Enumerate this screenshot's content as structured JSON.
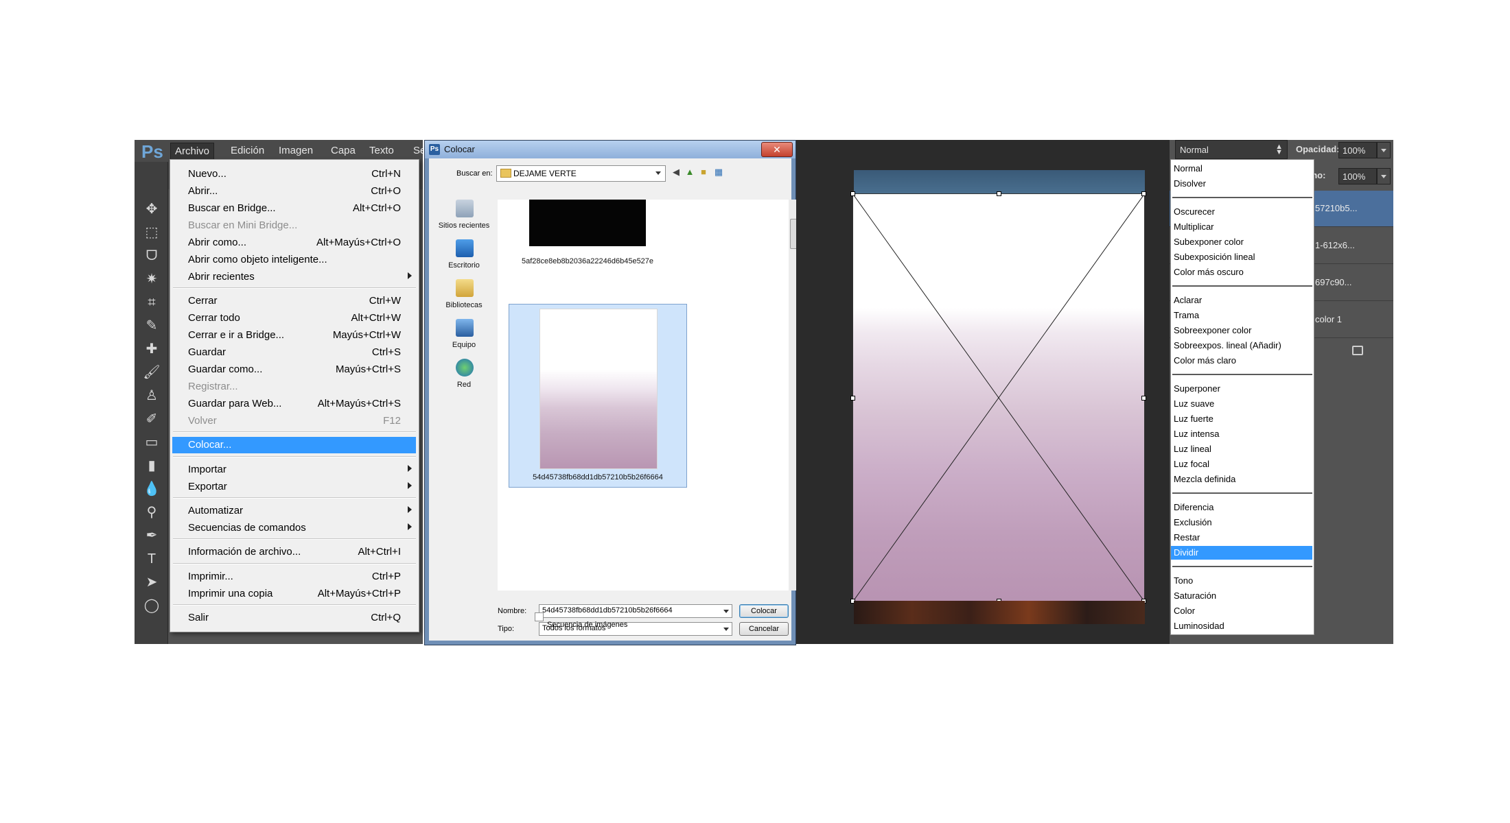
{
  "photoshop": {
    "logo": "Ps",
    "menubar": [
      "Archivo",
      "Edición",
      "Imagen",
      "Capa",
      "Texto",
      "Se"
    ],
    "archivo_menu": [
      {
        "label": "Nuevo...",
        "shortcut": "Ctrl+N"
      },
      {
        "label": "Abrir...",
        "shortcut": "Ctrl+O"
      },
      {
        "label": "Buscar en Bridge...",
        "shortcut": "Alt+Ctrl+O"
      },
      {
        "label": "Buscar en Mini Bridge...",
        "shortcut": ""
      },
      {
        "label": "Abrir como...",
        "shortcut": "Alt+Mayús+Ctrl+O"
      },
      {
        "label": "Abrir como objeto inteligente...",
        "shortcut": ""
      },
      {
        "label": "Abrir recientes",
        "shortcut": ""
      },
      {
        "label": "Cerrar",
        "shortcut": "Ctrl+W"
      },
      {
        "label": "Cerrar todo",
        "shortcut": "Alt+Ctrl+W"
      },
      {
        "label": "Cerrar e ir a Bridge...",
        "shortcut": "Mayús+Ctrl+W"
      },
      {
        "label": "Guardar",
        "shortcut": "Ctrl+S"
      },
      {
        "label": "Guardar como...",
        "shortcut": "Mayús+Ctrl+S"
      },
      {
        "label": "Registrar...",
        "shortcut": ""
      },
      {
        "label": "Guardar para Web...",
        "shortcut": "Alt+Mayús+Ctrl+S"
      },
      {
        "label": "Volver",
        "shortcut": "F12"
      },
      {
        "label": "Colocar...",
        "shortcut": ""
      },
      {
        "label": "Importar",
        "shortcut": ""
      },
      {
        "label": "Exportar",
        "shortcut": ""
      },
      {
        "label": "Automatizar",
        "shortcut": ""
      },
      {
        "label": "Secuencias de comandos",
        "shortcut": ""
      },
      {
        "label": "Información de archivo...",
        "shortcut": "Alt+Ctrl+I"
      },
      {
        "label": "Imprimir...",
        "shortcut": "Ctrl+P"
      },
      {
        "label": "Imprimir una copia",
        "shortcut": "Alt+Mayús+Ctrl+P"
      },
      {
        "label": "Salir",
        "shortcut": "Ctrl+Q"
      }
    ],
    "tool_icons": [
      "move-tool-icon",
      "marquee-tool-icon",
      "lasso-tool-icon",
      "magic-wand-icon",
      "crop-tool-icon",
      "eyedropper-icon",
      "healing-brush-icon",
      "brush-tool-icon",
      "stamp-tool-icon",
      "history-brush-icon",
      "eraser-icon",
      "gradient-tool-icon",
      "blur-tool-icon",
      "dodge-tool-icon",
      "pen-tool-icon",
      "type-tool-icon",
      "path-selection-icon",
      "ellipse-tool-icon"
    ]
  },
  "dialog": {
    "title": "Colocar",
    "look_in_label": "Buscar en:",
    "look_in_value": "DEJAME VERTE",
    "places": [
      "Sitios recientes",
      "Escritorio",
      "Bibliotecas",
      "Equipo",
      "Red"
    ],
    "files": [
      "5af28ce8eb8b2036a22246d6b45e527e",
      "54d45738fb68dd1db57210b5b26f6664"
    ],
    "name_label": "Nombre:",
    "name_value": "54d45738fb68dd1db57210b5b26f6664",
    "type_label": "Tipo:",
    "type_value": "Todos los formatos",
    "place_button": "Colocar",
    "cancel_button": "Cancelar",
    "sequence_label": "Secuencia de imágenes"
  },
  "layers": {
    "blend_mode": "Normal",
    "opacity_label": "Opacidad:",
    "opacity_value": "100%",
    "fill_label": "eno:",
    "fill_value": "100%",
    "layer_names": [
      "57210b5...",
      "1-612x6...",
      "697c90...",
      "color 1"
    ],
    "blend_modes": [
      [
        "Normal",
        "Disolver"
      ],
      [
        "Oscurecer",
        "Multiplicar",
        "Subexponer color",
        "Subexposición lineal",
        "Color más oscuro"
      ],
      [
        "Aclarar",
        "Trama",
        "Sobreexponer color",
        "Sobreexpos. lineal (Añadir)",
        "Color más claro"
      ],
      [
        "Superponer",
        "Luz suave",
        "Luz fuerte",
        "Luz intensa",
        "Luz lineal",
        "Luz focal",
        "Mezcla definida"
      ],
      [
        "Diferencia",
        "Exclusión",
        "Restar",
        "Dividir"
      ],
      [
        "Tono",
        "Saturación",
        "Color",
        "Luminosidad"
      ]
    ],
    "selected_blend_mode": "Dividir"
  }
}
